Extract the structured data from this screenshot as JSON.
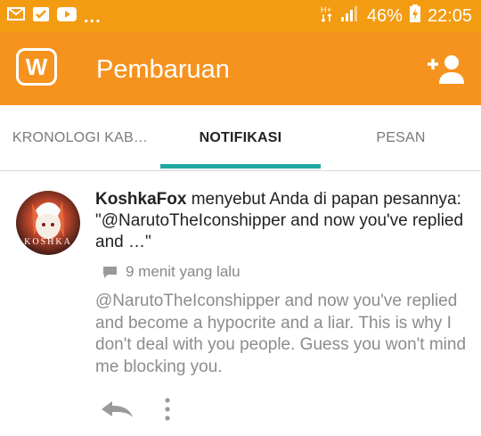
{
  "status_bar": {
    "dots": "...",
    "battery": "46%",
    "time": "22:05"
  },
  "app_bar": {
    "logo_letter": "W",
    "title": "Pembaruan"
  },
  "tabs": [
    {
      "label": "KRONOLOGI KAB…",
      "active": false
    },
    {
      "label": "NOTIFIKASI",
      "active": true
    },
    {
      "label": "PESAN",
      "active": false
    }
  ],
  "notification": {
    "avatar_text": "KOSHKA",
    "username": "KoshkaFox",
    "headline_rest": " menyebut Anda di papan pesannya: \"@NarutoTheIconshipper and now you've replied and …\"",
    "time_ago": "9 menit yang lalu",
    "message": "@NarutoTheIconshipper and now you've replied and become a hypocrite and a liar. This is why I don't deal with you people. Guess you won't mind me blocking you."
  },
  "colors": {
    "status_bar": "#f39c12",
    "app_bar": "#f6931e",
    "tab_indicator": "#1fa8a0"
  }
}
